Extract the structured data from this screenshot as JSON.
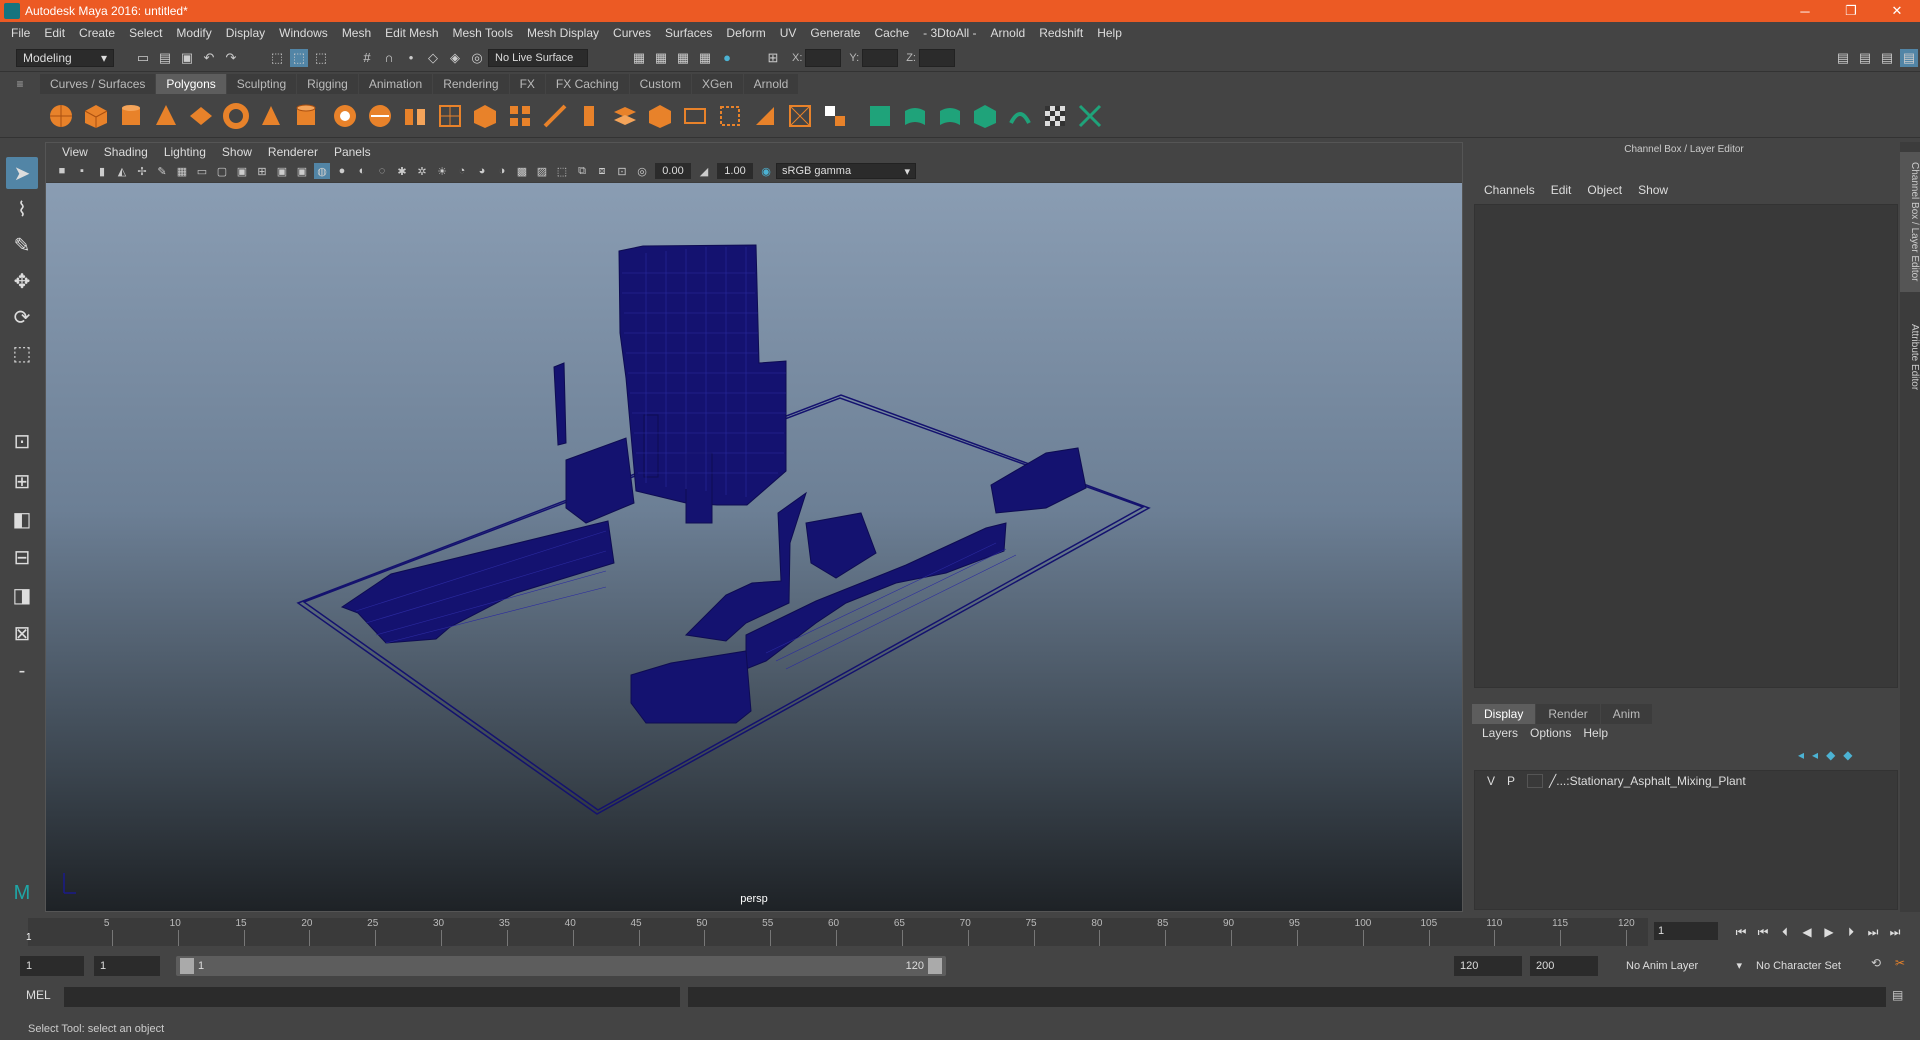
{
  "app": {
    "title": "Autodesk Maya 2016: untitled*"
  },
  "window_controls": {
    "minimize": "─",
    "maximize": "❐",
    "close": "✕"
  },
  "menubar": [
    "File",
    "Edit",
    "Create",
    "Select",
    "Modify",
    "Display",
    "Windows",
    "Mesh",
    "Edit Mesh",
    "Mesh Tools",
    "Mesh Display",
    "Curves",
    "Surfaces",
    "Deform",
    "UV",
    "Generate",
    "Cache",
    "- 3DtoAll -",
    "Arnold",
    "Redshift",
    "Help"
  ],
  "status_line": {
    "mode": "Modeling",
    "live_surface": "No Live Surface",
    "x_label": "X:",
    "y_label": "Y:",
    "z_label": "Z:"
  },
  "shelf_tabs": [
    {
      "label": "Curves / Surfaces",
      "active": false
    },
    {
      "label": "Polygons",
      "active": true
    },
    {
      "label": "Sculpting",
      "active": false
    },
    {
      "label": "Rigging",
      "active": false
    },
    {
      "label": "Animation",
      "active": false
    },
    {
      "label": "Rendering",
      "active": false
    },
    {
      "label": "FX",
      "active": false
    },
    {
      "label": "FX Caching",
      "active": false
    },
    {
      "label": "Custom",
      "active": false
    },
    {
      "label": "XGen",
      "active": false
    },
    {
      "label": "Arnold",
      "active": false
    }
  ],
  "shelf_icons": [
    "poly-sphere-icon",
    "poly-cube-icon",
    "poly-cylinder-icon",
    "poly-cone-icon",
    "poly-plane-icon",
    "poly-torus-icon",
    "poly-pyramid-icon",
    "poly-pipe-icon",
    "combine-icon",
    "separate-icon",
    "extract-icon",
    "smooth-icon",
    "boolean-icon",
    "average-icon",
    "bridge-icon",
    "extrude-icon",
    "append-icon",
    "fill-hole-icon",
    "merge-icon",
    "bevel-icon",
    "multi-cut-icon",
    "target-weld-icon",
    "uv-planar-icon",
    "uv-cylindrical-icon",
    "uv-spherical-icon",
    "uv-auto-icon",
    "uv-layout-icon",
    "uv-editor-icon",
    "checker-icon",
    "snap-icon"
  ],
  "viewport": {
    "menu": [
      "View",
      "Shading",
      "Lighting",
      "Show",
      "Renderer",
      "Panels"
    ],
    "exposure": "0.00",
    "gamma": "1.00",
    "color_space": "sRGB gamma",
    "camera_label": "persp"
  },
  "right_panel": {
    "title": "Channel Box / Layer Editor",
    "menu": [
      "Channels",
      "Edit",
      "Object",
      "Show"
    ],
    "layer_tabs": [
      {
        "label": "Display",
        "active": true
      },
      {
        "label": "Render",
        "active": false
      },
      {
        "label": "Anim",
        "active": false
      }
    ],
    "layer_menu": [
      "Layers",
      "Options",
      "Help"
    ],
    "layers": [
      {
        "v": "V",
        "p": "P",
        "name": "...:Stationary_Asphalt_Mixing_Plant"
      }
    ],
    "side_tabs": [
      "Channel Box / Layer Editor",
      "Attribute Editor"
    ]
  },
  "timeline": {
    "ticks": [
      "5",
      "10",
      "15",
      "20",
      "25",
      "30",
      "35",
      "40",
      "45",
      "50",
      "55",
      "60",
      "65",
      "70",
      "75",
      "80",
      "85",
      "90",
      "95",
      "100",
      "105",
      "110",
      "115",
      "120"
    ],
    "start_tick": "1",
    "current_frame": "1"
  },
  "range": {
    "start": "1",
    "playback_start": "1",
    "slider_start": "1",
    "slider_end": "120",
    "playback_end": "120",
    "end": "200",
    "anim_layer": "No Anim Layer",
    "character_set": "No Character Set"
  },
  "command_line": {
    "label": "MEL"
  },
  "help_line": "Select Tool: select an object"
}
